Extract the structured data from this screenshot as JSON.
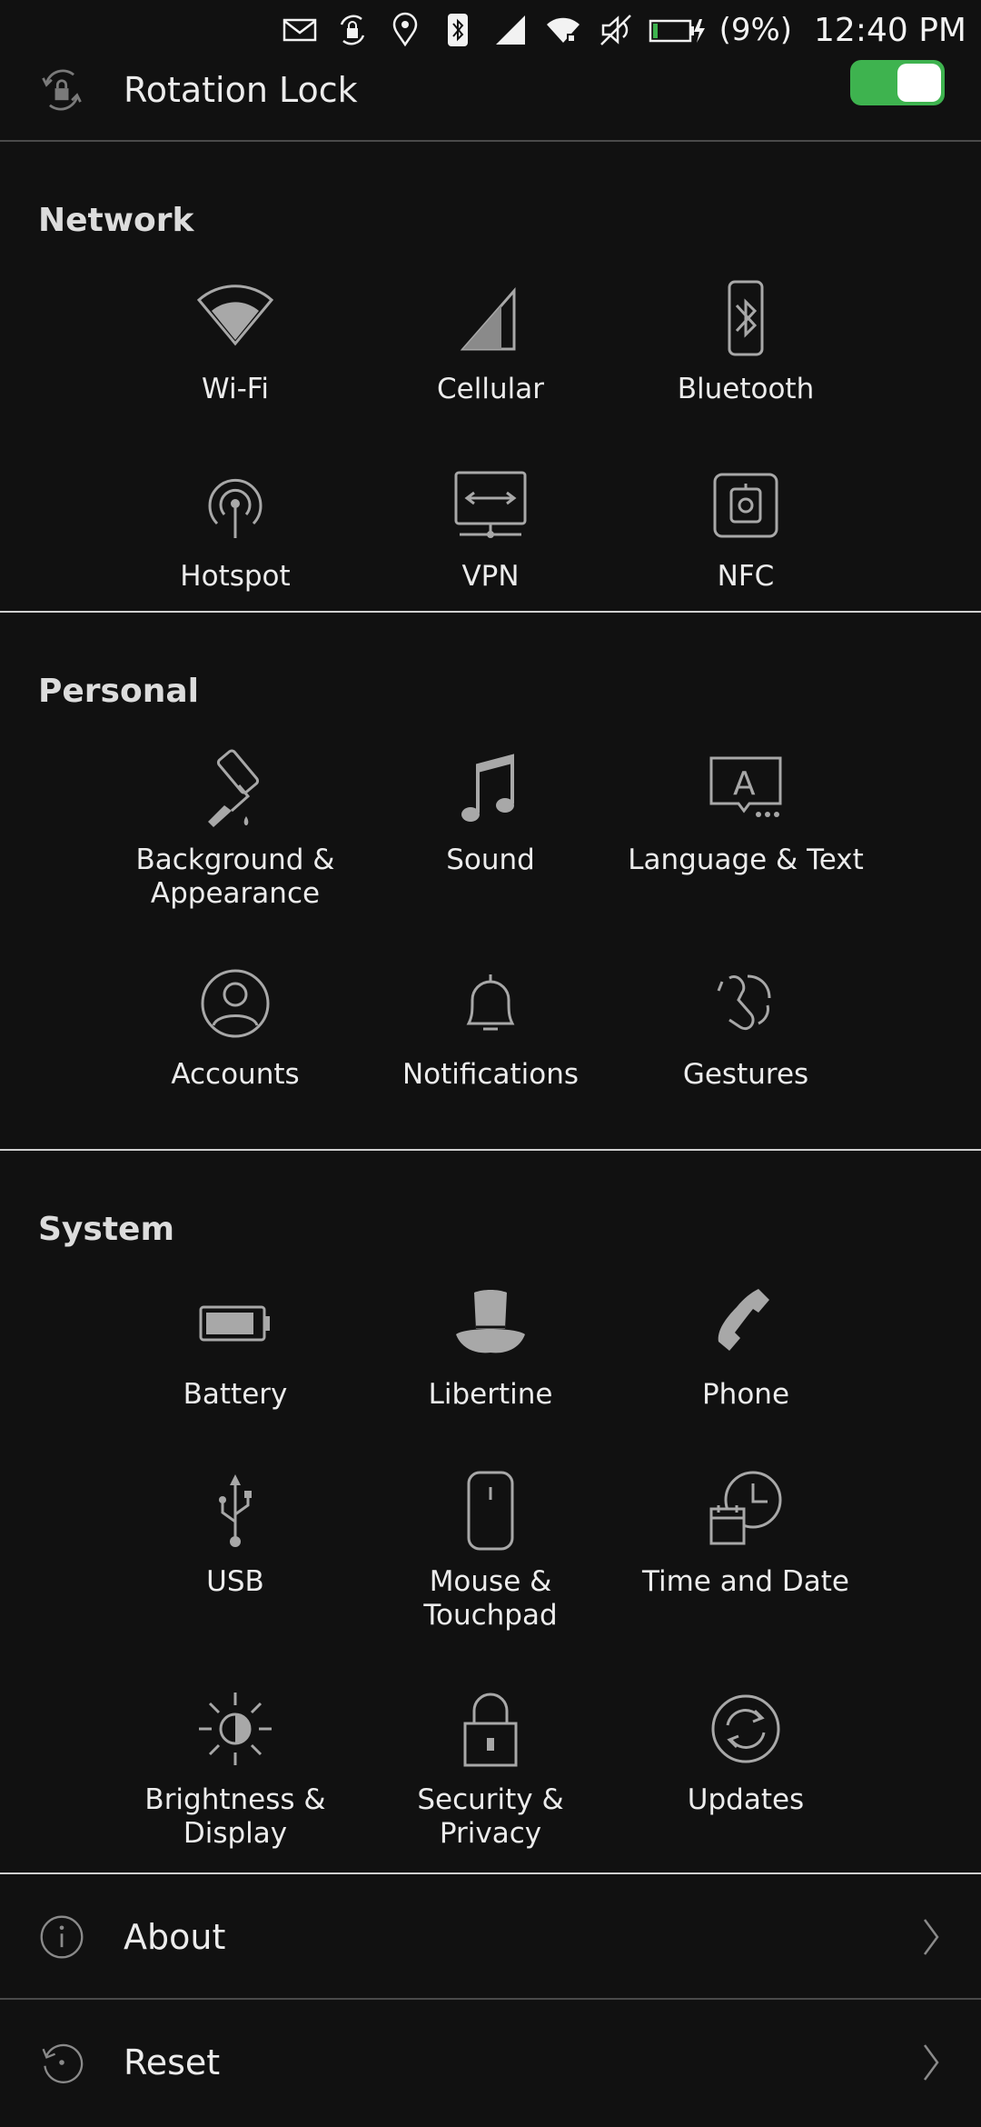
{
  "status_bar": {
    "battery_percent": "(9%)",
    "time": "12:40 PM",
    "icons": [
      "mail-icon",
      "rotation-lock-icon",
      "location-icon",
      "bluetooth-icon",
      "cellular-signal-icon",
      "wifi-icon",
      "mute-icon",
      "battery-charging-icon"
    ]
  },
  "rotation_lock": {
    "label": "Rotation Lock",
    "enabled": true
  },
  "network": {
    "title": "Network",
    "items": [
      {
        "label": "Wi-Fi",
        "icon": "wifi-icon"
      },
      {
        "label": "Cellular",
        "icon": "cellular-icon"
      },
      {
        "label": "Bluetooth",
        "icon": "bluetooth-icon"
      },
      {
        "label": "Hotspot",
        "icon": "hotspot-icon"
      },
      {
        "label": "VPN",
        "icon": "vpn-icon"
      },
      {
        "label": "NFC",
        "icon": "nfc-icon"
      }
    ]
  },
  "personal": {
    "title": "Personal",
    "items": [
      {
        "label": "Background & Appearance",
        "icon": "paint-roller-icon"
      },
      {
        "label": "Sound",
        "icon": "music-note-icon"
      },
      {
        "label": "Language & Text",
        "icon": "language-icon"
      },
      {
        "label": "Accounts",
        "icon": "account-icon"
      },
      {
        "label": "Notifications",
        "icon": "bell-icon"
      },
      {
        "label": "Gestures",
        "icon": "gesture-icon"
      }
    ]
  },
  "system": {
    "title": "System",
    "items": [
      {
        "label": "Battery",
        "icon": "battery-icon"
      },
      {
        "label": "Libertine",
        "icon": "top-hat-icon"
      },
      {
        "label": "Phone",
        "icon": "phone-icon"
      },
      {
        "label": "USB",
        "icon": "usb-icon"
      },
      {
        "label": "Mouse & Touchpad",
        "icon": "mouse-icon"
      },
      {
        "label": "Time and Date",
        "icon": "clock-calendar-icon"
      },
      {
        "label": "Brightness & Display",
        "icon": "brightness-icon"
      },
      {
        "label": "Security & Privacy",
        "icon": "lock-icon"
      },
      {
        "label": "Updates",
        "icon": "sync-icon"
      }
    ]
  },
  "list": {
    "about_label": "About",
    "reset_label": "Reset"
  },
  "colors": {
    "background": "#111111",
    "toggle_on": "#3eb34f",
    "icon": "#9a9a9a"
  }
}
